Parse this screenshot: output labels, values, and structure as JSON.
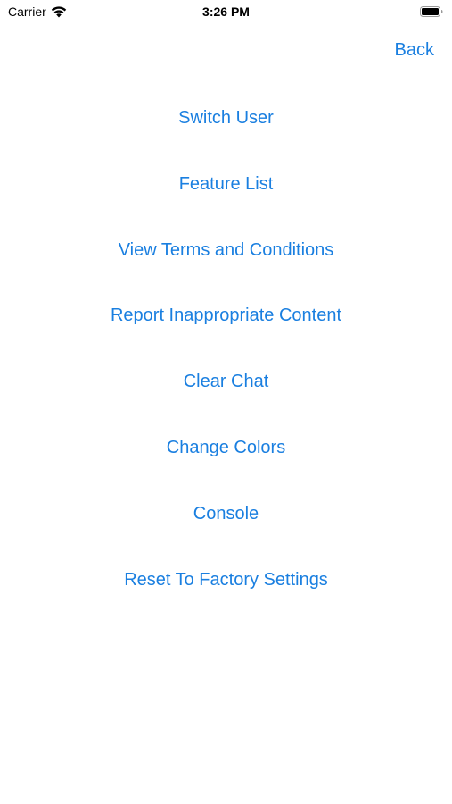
{
  "status_bar": {
    "carrier": "Carrier",
    "time": "3:26 PM",
    "wifi_icon": "wifi-icon",
    "battery_icon": "battery-icon"
  },
  "nav": {
    "back_label": "Back"
  },
  "menu": {
    "items": [
      {
        "label": "Switch User"
      },
      {
        "label": "Feature List"
      },
      {
        "label": "View Terms and Conditions"
      },
      {
        "label": "Report Inappropriate Content"
      },
      {
        "label": "Clear Chat"
      },
      {
        "label": "Change Colors"
      },
      {
        "label": "Console"
      },
      {
        "label": "Reset To Factory Settings"
      }
    ]
  },
  "colors": {
    "accent": "#1a7fe0",
    "background": "#ffffff",
    "text": "#000000"
  }
}
